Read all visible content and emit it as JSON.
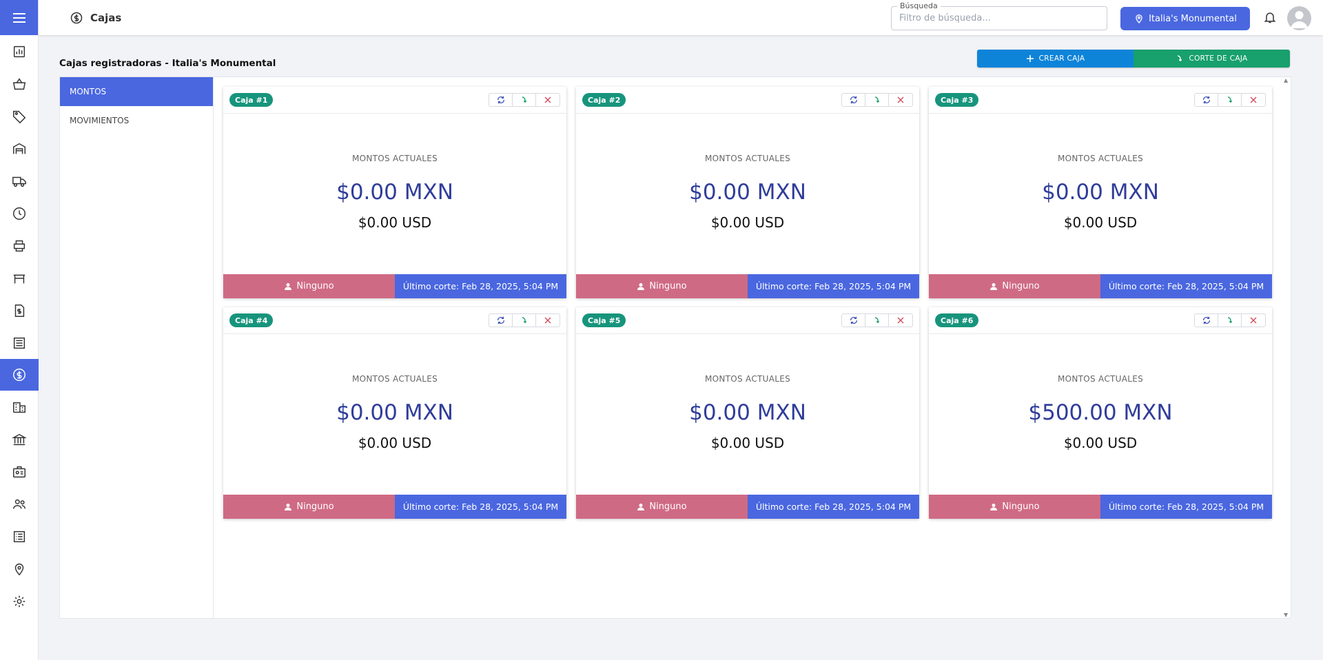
{
  "header": {
    "page_title": "Cajas",
    "search_label": "Búsqueda",
    "search_placeholder": "Filtro de búsqueda...",
    "search_value": "",
    "location": "Italia's Monumental"
  },
  "content": {
    "section_title": "Cajas registradoras - Italia's Monumental",
    "create_button": "CREAR CAJA",
    "cut_button": "CORTE DE CAJA"
  },
  "tabs": [
    "MONTOS",
    "MOVIMIENTOS"
  ],
  "cards": [
    {
      "label": "Caja #1",
      "montos_label": "MONTOS ACTUALES",
      "mxn": "$0.00 MXN",
      "usd": "$0.00 USD",
      "user": "Ninguno",
      "last_cut": "Último corte: Feb 28, 2025, 5:04 PM"
    },
    {
      "label": "Caja #2",
      "montos_label": "MONTOS ACTUALES",
      "mxn": "$0.00 MXN",
      "usd": "$0.00 USD",
      "user": "Ninguno",
      "last_cut": "Último corte: Feb 28, 2025, 5:04 PM"
    },
    {
      "label": "Caja #3",
      "montos_label": "MONTOS ACTUALES",
      "mxn": "$0.00 MXN",
      "usd": "$0.00 USD",
      "user": "Ninguno",
      "last_cut": "Último corte: Feb 28, 2025, 5:04 PM"
    },
    {
      "label": "Caja #4",
      "montos_label": "MONTOS ACTUALES",
      "mxn": "$0.00 MXN",
      "usd": "$0.00 USD",
      "user": "Ninguno",
      "last_cut": "Último corte: Feb 28, 2025, 5:04 PM"
    },
    {
      "label": "Caja #5",
      "montos_label": "MONTOS ACTUALES",
      "mxn": "$0.00 MXN",
      "usd": "$0.00 USD",
      "user": "Ninguno",
      "last_cut": "Último corte: Feb 28, 2025, 5:04 PM"
    },
    {
      "label": "Caja #6",
      "montos_label": "MONTOS ACTUALES",
      "mxn": "$500.00 MXN",
      "usd": "$0.00 USD",
      "user": "Ninguno",
      "last_cut": "Último corte: Feb 28, 2025, 5:04 PM"
    }
  ],
  "rail_icons": [
    "menu-icon",
    "chart-icon",
    "basket-icon",
    "tag-icon",
    "warehouse-icon",
    "truck-icon",
    "clock-icon",
    "printer-icon",
    "bench-icon",
    "invoice-icon",
    "list-icon",
    "dollar-icon",
    "building-icon",
    "bank-icon",
    "badge-icon",
    "users-icon",
    "table-list-icon",
    "location-pin-icon",
    "gear-icon"
  ],
  "colors": {
    "primary": "#4a67e0",
    "create": "#0e84d9",
    "cut": "#18a06d",
    "badge": "#17947c",
    "user_footer": "#cf6a85",
    "amount": "#2f3d9a"
  }
}
